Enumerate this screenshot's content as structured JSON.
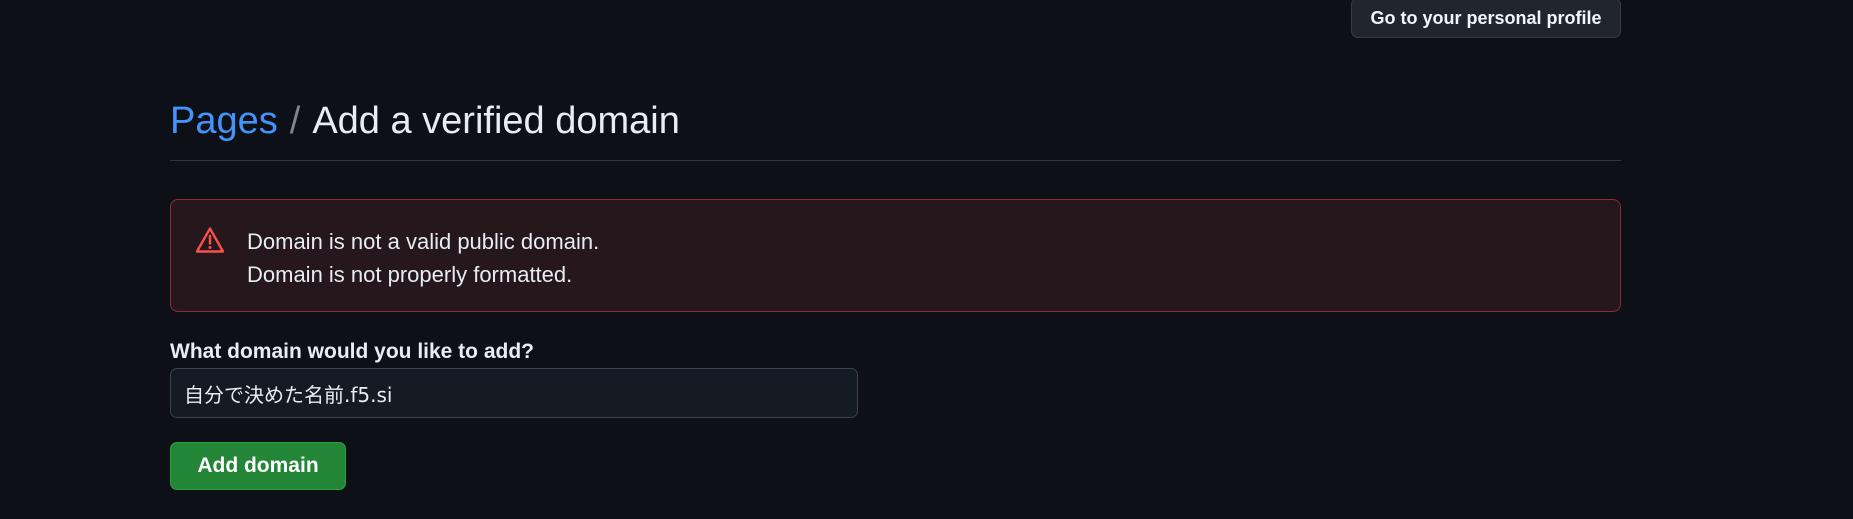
{
  "top_bar": {
    "profile_button_label": "Go to your personal profile"
  },
  "header": {
    "breadcrumb_link": "Pages",
    "breadcrumb_separator": "/",
    "title": "Add a verified domain"
  },
  "flash": {
    "icon": "alert-icon",
    "messages": [
      "Domain is not a valid public domain.",
      "Domain is not properly formatted."
    ]
  },
  "form": {
    "domain_label": "What domain would you like to add?",
    "domain_value": "自分で決めた名前.f5.si",
    "submit_label": "Add domain"
  },
  "colors": {
    "background": "#0d1117",
    "link": "#4493f8",
    "error_border": "#8e2d2f",
    "error_background": "#25171c",
    "error_icon": "#f85149",
    "primary_button": "#238636"
  }
}
